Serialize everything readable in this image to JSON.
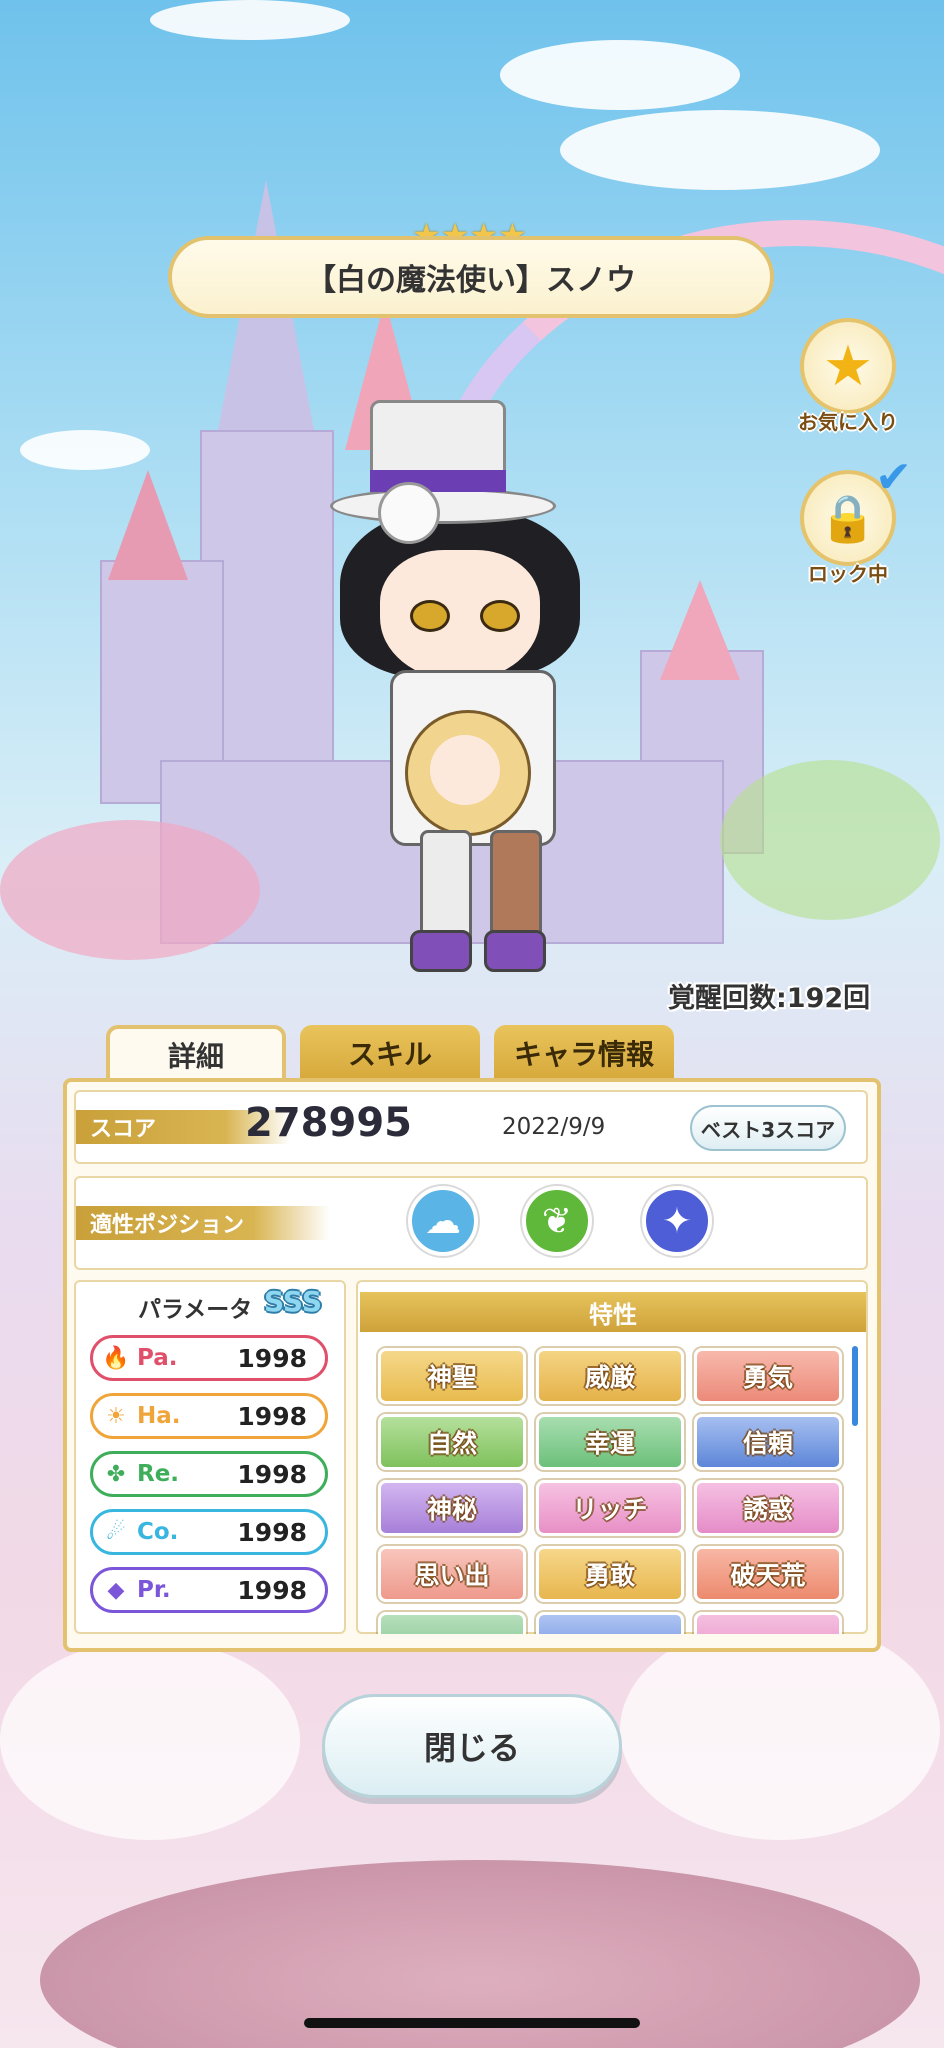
{
  "card": {
    "rarity_stars": "★★★★",
    "title": "【白の魔法使い】スノウ"
  },
  "side_buttons": {
    "favorite": {
      "icon": "★",
      "label": "お気に入り"
    },
    "lock": {
      "icon": "🔒",
      "label": "ロック中",
      "check": "✔"
    }
  },
  "awakening": "覚醒回数:192回",
  "tabs": [
    {
      "label": "詳細",
      "active": true
    },
    {
      "label": "スキル",
      "active": false
    },
    {
      "label": "キャラ情報",
      "active": false
    }
  ],
  "score": {
    "label": "スコア",
    "value": "278995",
    "date": "2022/9/9",
    "best_button": "ベスト3スコア"
  },
  "position": {
    "label": "適性ポジション",
    "icons": [
      {
        "name": "cloud-position-icon",
        "glyph": "☁",
        "color": "#5ab4e6"
      },
      {
        "name": "leaf-position-icon",
        "glyph": "❦",
        "color": "#5fb83a"
      },
      {
        "name": "rocket-position-icon",
        "glyph": "✦",
        "color": "#4d5ed6"
      }
    ]
  },
  "parameters": {
    "title": "パラメータ",
    "rank": "SSS",
    "items": [
      {
        "label": "Pa.",
        "value": "1998",
        "icon": "🔥",
        "color": "#e0506a"
      },
      {
        "label": "Ha.",
        "value": "1998",
        "icon": "☀",
        "color": "#f0a53a"
      },
      {
        "label": "Re.",
        "value": "1998",
        "icon": "✤",
        "color": "#3fae5a"
      },
      {
        "label": "Co.",
        "value": "1998",
        "icon": "☄",
        "color": "#39b6df"
      },
      {
        "label": "Pr.",
        "value": "1998",
        "icon": "◆",
        "color": "#7b56d8"
      }
    ]
  },
  "traits": {
    "title": "特性",
    "items": [
      {
        "label": "神聖",
        "color": "#e8bb4e"
      },
      {
        "label": "威厳",
        "color": "#e5b24a"
      },
      {
        "label": "勇気",
        "color": "#ec8a7a"
      },
      {
        "label": "自然",
        "color": "#7fc15c"
      },
      {
        "label": "幸運",
        "color": "#6cc07a"
      },
      {
        "label": "信頼",
        "color": "#5d86d8"
      },
      {
        "label": "神秘",
        "color": "#a77fd8"
      },
      {
        "label": "リッチ",
        "color": "#e88fc6"
      },
      {
        "label": "誘惑",
        "color": "#e58cc8"
      },
      {
        "label": "思い出",
        "color": "#ee9a8c"
      },
      {
        "label": "勇敢",
        "color": "#e7b64e"
      },
      {
        "label": "破天荒",
        "color": "#ec8a6e"
      },
      {
        "label": "",
        "color": "#7fc18a"
      },
      {
        "label": "",
        "color": "#6a8ee0"
      },
      {
        "label": "",
        "color": "#e98cc4"
      }
    ]
  },
  "close_button": "閉じる"
}
